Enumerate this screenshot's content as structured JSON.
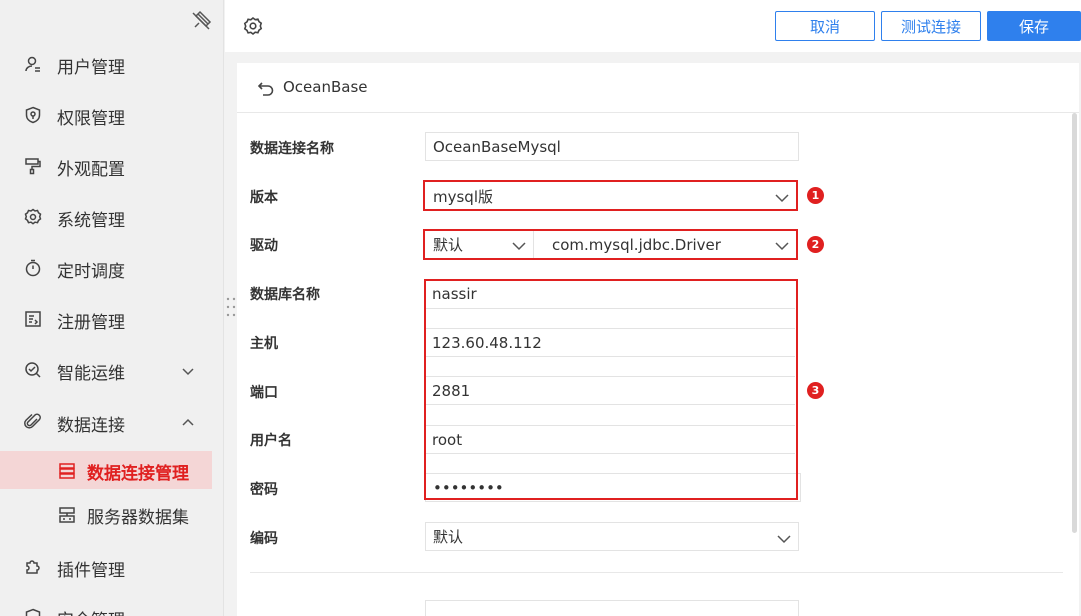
{
  "sidebar": {
    "items": [
      {
        "label": "用户管理"
      },
      {
        "label": "权限管理"
      },
      {
        "label": "外观配置"
      },
      {
        "label": "系统管理"
      },
      {
        "label": "定时调度"
      },
      {
        "label": "注册管理"
      },
      {
        "label": "智能运维"
      },
      {
        "label": "数据连接"
      },
      {
        "label": "插件管理"
      },
      {
        "label": "安全管理"
      }
    ],
    "subitems": [
      {
        "label": "数据连接管理"
      },
      {
        "label": "服务器数据集"
      }
    ]
  },
  "toolbar": {
    "cancel_label": "取消",
    "test_label": "测试连接",
    "save_label": "保存"
  },
  "form": {
    "title": "OceanBase",
    "fields": {
      "name": {
        "label": "数据连接名称",
        "value": "OceanBaseMysql"
      },
      "version": {
        "label": "版本",
        "value": "mysql版"
      },
      "driver": {
        "label": "驱动",
        "mode": "默认",
        "value": "com.mysql.jdbc.Driver"
      },
      "database": {
        "label": "数据库名称",
        "value": "nassir"
      },
      "host": {
        "label": "主机",
        "value": "123.60.48.112"
      },
      "port": {
        "label": "端口",
        "value": "2881"
      },
      "username": {
        "label": "用户名",
        "value": "root"
      },
      "password": {
        "label": "密码",
        "value": "••••••••"
      },
      "encoding": {
        "label": "编码",
        "value": "默认"
      }
    }
  },
  "badges": [
    "1",
    "2",
    "3"
  ],
  "colors": {
    "accent": "#2f80ed",
    "highlight": "#e02020",
    "active_bg": "#f4d6d6"
  }
}
